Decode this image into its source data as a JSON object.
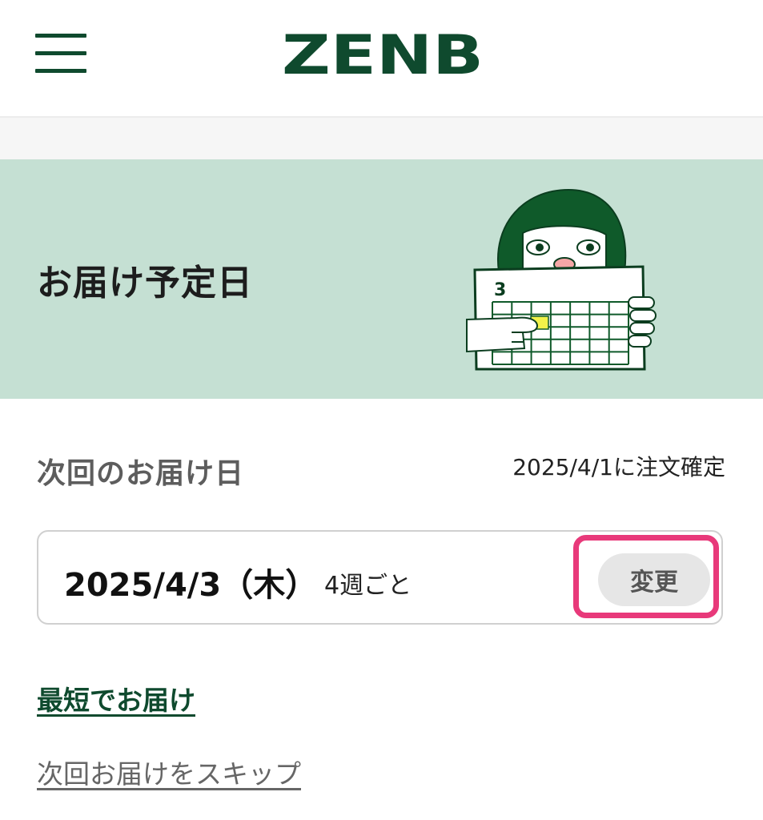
{
  "header": {
    "logo_text": "ZENB",
    "menu_icon": "hamburger-menu-icon",
    "brand_color": "#0f4a2e"
  },
  "hero": {
    "title": "お届け予定日",
    "illustration": "person-holding-calendar-illustration",
    "calendar_month": "3",
    "background_color": "#c5e0d3"
  },
  "next_delivery": {
    "label": "次回のお届け日",
    "confirm_note": "2025/4/1に注文確定",
    "date": "2025/4/3（木）",
    "cycle": "4週ごと",
    "change_label": "変更",
    "highlight_color": "#e8397a"
  },
  "links": {
    "shortest": "最短でお届け",
    "skip": "次回お届けをスキップ"
  }
}
